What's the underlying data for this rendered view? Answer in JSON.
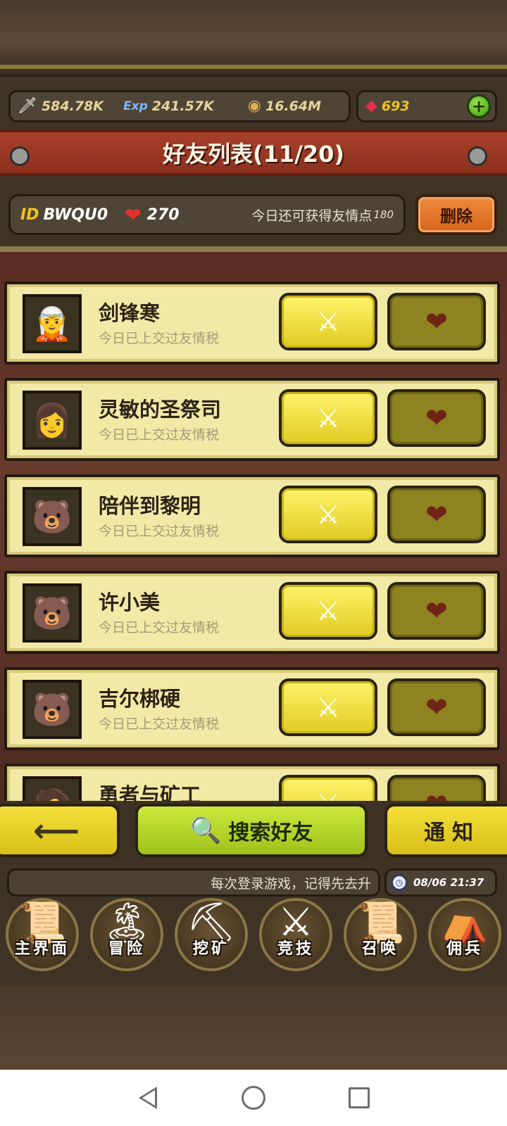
{
  "resources": {
    "attack": {
      "icon": "sword-icon",
      "value": "584.78K"
    },
    "exp": {
      "icon": "exp-icon",
      "value": "241.57K"
    },
    "gold": {
      "icon": "gold-coin-icon",
      "value": "16.64M"
    },
    "gems": {
      "icon": "ruby-icon",
      "value": "693"
    },
    "add": "+"
  },
  "title": "好友列表(11/20)",
  "info": {
    "id_label": "ID",
    "id_value": "BWQU0",
    "hearts": "270",
    "today_text": "今日还可获得友情点",
    "today_num": "180",
    "delete": "删除"
  },
  "friends": [
    {
      "name": "剑锋寒",
      "status": "今日已上交过友情税",
      "avatar": "🧝"
    },
    {
      "name": "灵敏的圣祭司",
      "status": "今日已上交过友情税",
      "avatar": "👩"
    },
    {
      "name": "陪伴到黎明",
      "status": "今日已上交过友情税",
      "avatar": "🐻"
    },
    {
      "name": "许小美",
      "status": "今日已上交过友情税",
      "avatar": "🐻"
    },
    {
      "name": "吉尔梆硬",
      "status": "今日已上交过友情税",
      "avatar": "🐻"
    },
    {
      "name": "勇者与矿工",
      "status": "",
      "avatar": "🧑"
    }
  ],
  "row_icons": {
    "battle": "⚔",
    "heart": "❤"
  },
  "actions": {
    "back": "⟵",
    "search": "搜索好友",
    "notice": "通知"
  },
  "ticker": "每次登录游戏，记得先去升",
  "clock": "08/06 21:37",
  "nav": [
    {
      "label": "主界面",
      "icon": "📜"
    },
    {
      "label": "冒险",
      "icon": "🏝"
    },
    {
      "label": "挖矿",
      "icon": "⛏"
    },
    {
      "label": "竞技",
      "icon": "⚔"
    },
    {
      "label": "召唤",
      "icon": "📜"
    },
    {
      "label": "佣兵",
      "icon": "⛺"
    }
  ],
  "colors": {
    "banner": "#a8412a",
    "row_bg": "#f3e9a6",
    "battle_btn": "#f0dc30",
    "heart_btn": "#8d8320",
    "search_btn": "#b8d82a"
  }
}
